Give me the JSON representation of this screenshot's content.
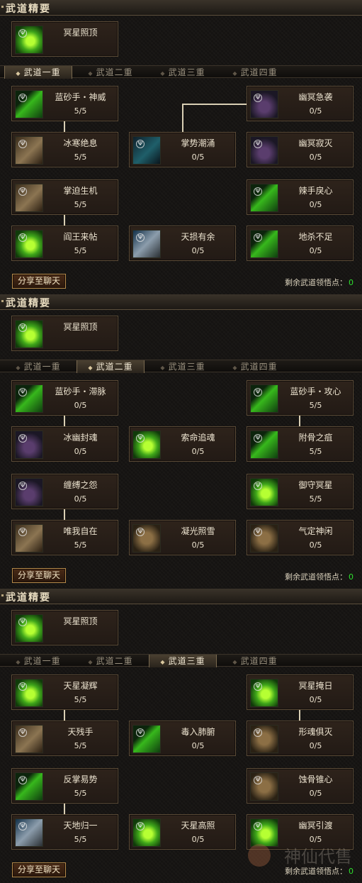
{
  "section_title": "武道精要",
  "tabs": [
    "武道一重",
    "武道二重",
    "武道三重",
    "武道四重"
  ],
  "share_label": "分享至聊天",
  "remaining_label": "剩余武道领悟点：",
  "remaining_value": "0",
  "watermark": "神仙代售",
  "panels": [
    {
      "active_tab": 0,
      "essence": {
        "name": "冥星照顶",
        "icon": "green-burst-icon"
      },
      "skills": {
        "l1": {
          "name": "蓝砂手・神威",
          "points": "5/5",
          "icon": "dark-figure-icon"
        },
        "l2": {
          "name": "冰寒绝息",
          "points": "5/5",
          "icon": "arm-strike-icon"
        },
        "l3": {
          "name": "掌迫生机",
          "points": "5/5",
          "icon": "moon-warrior-icon"
        },
        "l4": {
          "name": "阎王来帖",
          "points": "5/5",
          "icon": "green-figure-icon"
        },
        "m2": {
          "name": "掌势潮涌",
          "points": "0/5",
          "icon": "teal-wave-icon"
        },
        "m4": {
          "name": "天损有余",
          "points": "0/5",
          "icon": "blue-slash-icon"
        },
        "r1": {
          "name": "幽冥急袭",
          "points": "0/5",
          "icon": "purple-shadow-icon"
        },
        "r2": {
          "name": "幽冥寂灭",
          "points": "0/5",
          "icon": "purple-shadow-icon"
        },
        "r3": {
          "name": "辣手戾心",
          "points": "0/5",
          "icon": "green-claw-icon"
        },
        "r4": {
          "name": "地杀不足",
          "points": "0/5",
          "icon": "green-slash-icon"
        }
      }
    },
    {
      "active_tab": 1,
      "essence": {
        "name": "冥星照顶",
        "icon": "green-burst-icon"
      },
      "skills": {
        "l1": {
          "name": "蓝砂手・滞脉",
          "points": "0/5",
          "icon": "dark-figure-icon"
        },
        "l2": {
          "name": "冰幽封魂",
          "points": "0/5",
          "icon": "purple-shadow-icon"
        },
        "l3": {
          "name": "缠缚之怨",
          "points": "0/5",
          "icon": "purple-shadow-icon"
        },
        "l4": {
          "name": "唯我自在",
          "points": "5/5",
          "icon": "golden-warrior-icon"
        },
        "m2": {
          "name": "索命追魂",
          "points": "0/5",
          "icon": "green-figure-icon"
        },
        "m4": {
          "name": "凝光照雪",
          "points": "0/5",
          "icon": "bronze-pillar-icon"
        },
        "r1": {
          "name": "蓝砂手・攻心",
          "points": "5/5",
          "icon": "green-claw-icon"
        },
        "r2": {
          "name": "附骨之疽",
          "points": "5/5",
          "icon": "green-slash-icon"
        },
        "r3": {
          "name": "御守冥星",
          "points": "5/5",
          "icon": "green-burst-icon"
        },
        "r4": {
          "name": "气定神闲",
          "points": "0/5",
          "icon": "bronze-orb-icon"
        }
      }
    },
    {
      "active_tab": 2,
      "essence": {
        "name": "冥星照顶",
        "icon": "green-burst-icon"
      },
      "skills": {
        "l1": {
          "name": "天星凝辉",
          "points": "5/5",
          "icon": "green-burst-icon"
        },
        "l2": {
          "name": "天残手",
          "points": "5/5",
          "icon": "arm-strike-icon"
        },
        "l3": {
          "name": "反掌易势",
          "points": "5/5",
          "icon": "green-swirl-icon"
        },
        "l4": {
          "name": "天地归一",
          "points": "5/5",
          "icon": "blue-slash-icon"
        },
        "m2": {
          "name": "毒入肺腑",
          "points": "0/5",
          "icon": "green-slash-icon"
        },
        "m4": {
          "name": "天星高照",
          "points": "0/5",
          "icon": "green-burst-icon"
        },
        "r1": {
          "name": "冥星掩日",
          "points": "0/5",
          "icon": "green-burst-icon"
        },
        "r2": {
          "name": "形魂俱灭",
          "points": "0/5",
          "icon": "skull-icon"
        },
        "r3": {
          "name": "蚀骨锥心",
          "points": "0/5",
          "icon": "bronze-hand-icon"
        },
        "r4": {
          "name": "幽冥引渡",
          "points": "0/5",
          "icon": "green-figure-icon"
        }
      }
    }
  ]
}
